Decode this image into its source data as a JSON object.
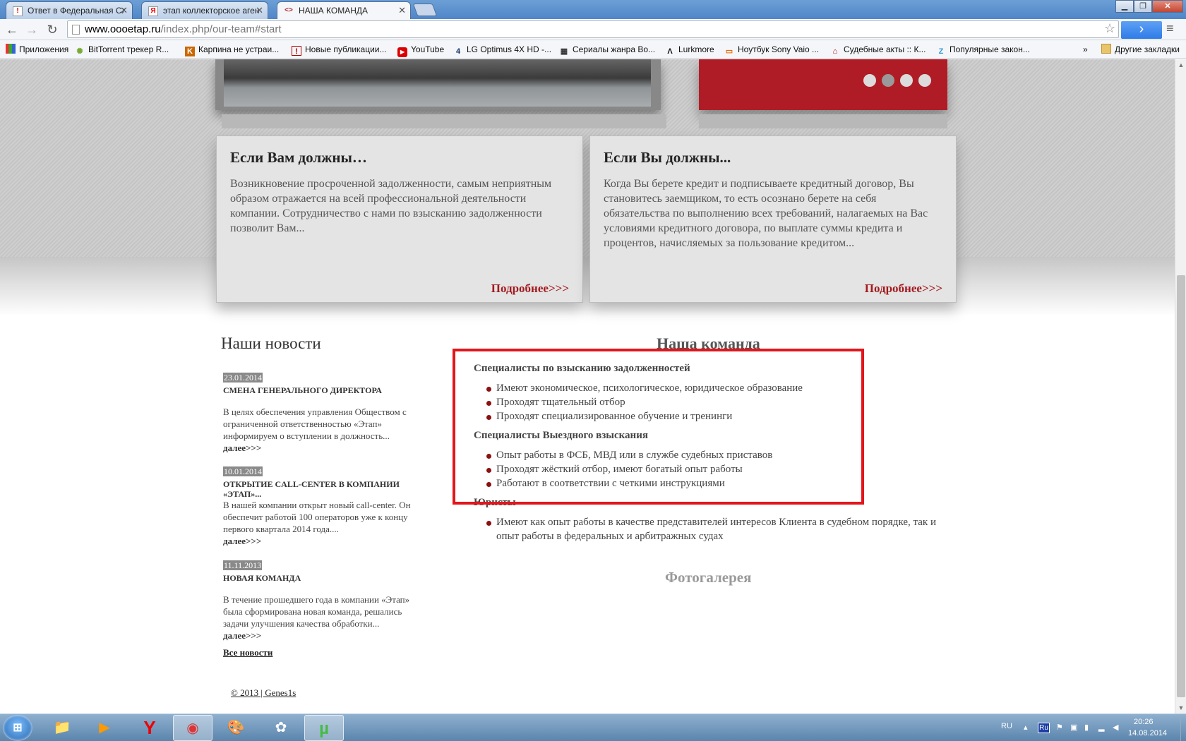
{
  "browser": {
    "tabs": [
      {
        "title": "Ответ в Федеральная Слу",
        "favicon": "!",
        "active": false
      },
      {
        "title": "этап коллекторское аген",
        "favicon": "Я",
        "active": false
      },
      {
        "title": "НАША КОМАНДА",
        "favicon": "<>",
        "active": true
      }
    ],
    "url_host": "www.oooetap.ru",
    "url_path": "/index.php/our-team#start",
    "window_buttons": {
      "minimize": "▁",
      "maximize": "❐",
      "close": "✕"
    },
    "nav": {
      "back": "←",
      "forward": "→",
      "reload": "↻",
      "star": "☆",
      "go": "›",
      "menu": "≡"
    },
    "bookmarks": [
      {
        "label": "Приложения",
        "icon": "apps-grid-icon"
      },
      {
        "label": "BitTorrent трекер R...",
        "icon": "bittorrent-icon"
      },
      {
        "label": "Карпина не устраи...",
        "icon": "shield-icon"
      },
      {
        "label": "Новые публикации...",
        "icon": "alert-icon"
      },
      {
        "label": "YouTube",
        "icon": "youtube-icon"
      },
      {
        "label": "LG Optimus 4X HD -...",
        "icon": "4pda-icon"
      },
      {
        "label": "Сериалы жанра Во...",
        "icon": "film-icon"
      },
      {
        "label": "Lurkmore",
        "icon": "lurkmore-icon"
      },
      {
        "label": "Ноутбук Sony Vaio ...",
        "icon": "shop-icon"
      },
      {
        "label": "Судебные акты :: К...",
        "icon": "court-icon"
      },
      {
        "label": "Популярные закон...",
        "icon": "z-icon"
      }
    ],
    "bookmarks_overflow": "»",
    "other_bookmarks": "Другие закладки"
  },
  "slider": {
    "dots": 4,
    "active_dot": 2
  },
  "cards": [
    {
      "title": "Если Вам должны…",
      "text": "Возникновение просроченной задолженности, самым неприятным образом отражается на всей профессиональной деятельности компании. Сотрудничество с нами по взысканию задолженности позволит Вам...",
      "more": "Подробнее>>>"
    },
    {
      "title": "Если Вы должны...",
      "text": "Когда Вы берете кредит и подписываете кредитный договор, Вы становитесь заемщиком, то есть осознано берете на себя обязательства по выполнению всех требований, налагаемых на Вас условиями кредитного договора, по выплате суммы кредита и процентов, начисляемых за пользование кредитом...",
      "more": "Подробнее>>>"
    }
  ],
  "news": {
    "title": "Наши новости",
    "items": [
      {
        "date": "23.01.2014",
        "headline": "СМЕНА ГЕНЕРАЛЬНОГО ДИРЕКТОРА",
        "text": "В целях обеспечения управления Обществом с ограниченной ответственностью «Этап» информируем о вступлении в должность...",
        "more": "далее>>>"
      },
      {
        "date": "10.01.2014",
        "headline": "ОТКРЫТИЕ CALL-CENTER В КОМПАНИИ «ЭТАП»...",
        "text": "В нашей компании открыт новый call-center. Он обеспечит работой 100 операторов уже к концу первого квартала 2014 года....",
        "more": "далее>>>"
      },
      {
        "date": "11.11.2013",
        "headline": "НОВАЯ КОМАНДА",
        "text": "В течение прошедшего года в компании «Этап» была сформирована новая команда, решались задачи улучшения качества обработки...",
        "more": "далее>>>"
      }
    ],
    "all_news": "Все новости"
  },
  "team": {
    "title": "Наша команда",
    "sections": [
      {
        "title": "Специалисты по взысканию задолженностей",
        "items": [
          "Имеют экономическое, психологическое, юридическое образование",
          "Проходят тщательный отбор",
          "Проходят специализированное обучение и тренинги"
        ]
      },
      {
        "title": "Специалисты Выездного взыскания",
        "items": [
          "Опыт работы в ФСБ, МВД или в службе судебных приставов",
          "Проходят жёсткий отбор, имеют богатый опыт работы",
          "Работают в соответствии с четкими инструкциями"
        ]
      },
      {
        "title": "Юристы",
        "items": [
          "Имеют как опыт работы в качестве представителей интересов Клиента в судебном порядке, так и опыт работы в федеральных и арбитражных судах"
        ]
      }
    ],
    "gallery_title": "Фотогалерея"
  },
  "footer": {
    "copyright": "© 2013 | Genes1s"
  },
  "scrollbar": {
    "up": "▲",
    "down": "▼"
  },
  "taskbar": {
    "start": "⊞",
    "apps": [
      {
        "name": "explorer-icon",
        "glyph": "📁",
        "active": false
      },
      {
        "name": "media-player-icon",
        "glyph": "▶",
        "active": false
      },
      {
        "name": "yandex-browser-icon",
        "glyph": "Y",
        "active": false
      },
      {
        "name": "chrome-icon",
        "glyph": "◉",
        "active": true
      },
      {
        "name": "paint-icon",
        "glyph": "🎨",
        "active": false
      },
      {
        "name": "qip-icon",
        "glyph": "✿",
        "active": false
      },
      {
        "name": "utorrent-icon",
        "glyph": "µ",
        "active": true
      }
    ],
    "lang": "RU",
    "keyboard_badge": "Ru",
    "time": "20:26",
    "date": "14.08.2014"
  },
  "colors": {
    "accent_red": "#b01c25",
    "highlight_box": "#e2161c",
    "link_red": "#a31a1e",
    "bullet": "#8b1010"
  }
}
